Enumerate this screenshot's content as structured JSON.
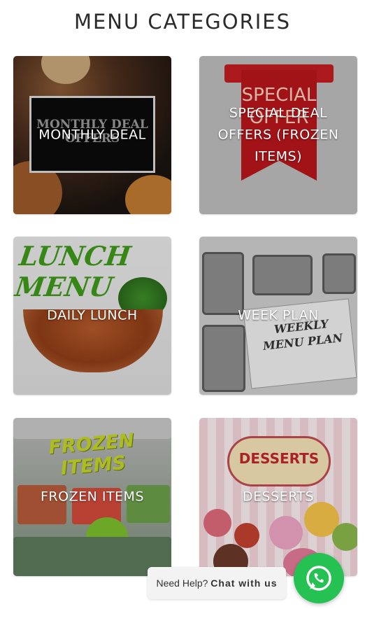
{
  "page": {
    "title": "MENU CATEGORIES"
  },
  "categories": [
    {
      "label": "MONTHLY DEAL",
      "art_text": "MONTHLY DEAL OFFERS"
    },
    {
      "label": "SPECIAL DEAL OFFERS (FROZEN ITEMS)",
      "art_text": "SPECIAL OFFER"
    },
    {
      "label": "DAILY LUNCH",
      "art_text": "LUNCH MENU"
    },
    {
      "label": "WEEK PLAN",
      "art_text": "WEEKLY MENU PLAN"
    },
    {
      "label": "FROZEN ITEMS",
      "art_text": "FROZEN ITEMS"
    },
    {
      "label": "DESSERTS",
      "art_text": "DESSERTS"
    }
  ],
  "chat": {
    "help_text": "Need Help?",
    "cta_text": "Chat with us",
    "icon": "whatsapp-icon"
  },
  "colors": {
    "whatsapp_green": "#25c152",
    "title": "#2b2b2b"
  }
}
